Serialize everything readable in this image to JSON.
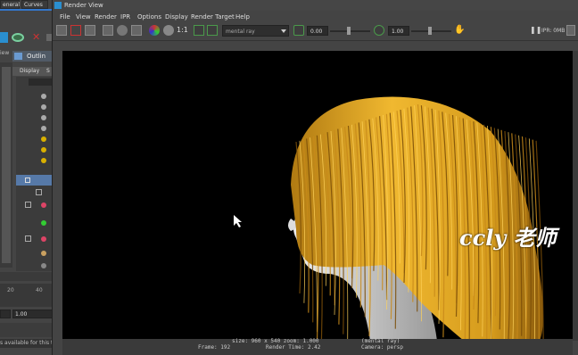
{
  "left_panel": {
    "tabs": [
      "eneral",
      "Curves"
    ],
    "outliner_title": "Outlin",
    "display_menu": "Display",
    "display_menu_2": "S",
    "timeline_ticks": [
      "20",
      "40"
    ],
    "frame_field": "1.00",
    "help_text": "s available for this to"
  },
  "render_view": {
    "title": "Render View",
    "menus": [
      "File",
      "View",
      "Render",
      "IPR",
      "Options",
      "Display",
      "Render Target",
      "Help"
    ],
    "ratio_label": "1:1",
    "renderer": "mental ray",
    "exposure": "0.00",
    "gamma": "1.00",
    "ipr_status": "IPR: 0MB",
    "status": {
      "size_line": "size: 960 x 540  zoom: 1.000",
      "renderer_line": "(mental ray)",
      "frame_line": "Frame: 192",
      "time_line": "Render Time:  2.42",
      "camera_line": "Camera: persp"
    },
    "watermark": "ccly 老师",
    "colors": {
      "hair": "#E0A620",
      "skin": "#D8D8D8",
      "bg": "#000000"
    }
  }
}
